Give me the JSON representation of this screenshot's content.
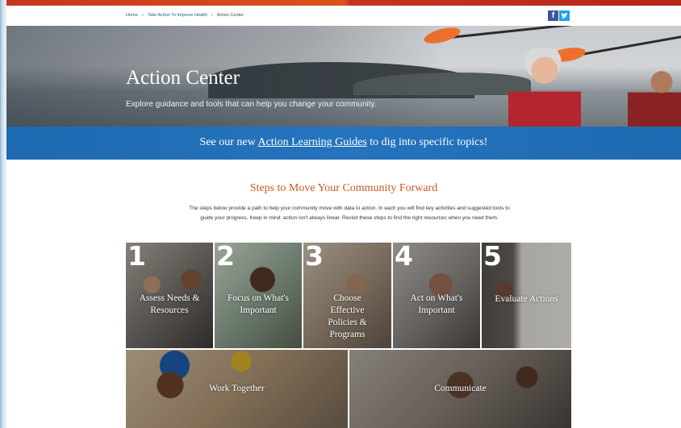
{
  "breadcrumb": {
    "home": "Home",
    "sep1": "»",
    "parent": "Take Action To Improve Health",
    "sep2": "»",
    "current": "Action Center"
  },
  "social": {
    "facebook": "f",
    "twitter": "t"
  },
  "hero": {
    "title": "Action Center",
    "subtitle": "Explore guidance and tools that can help you change your community."
  },
  "banner": {
    "prefix": "See our new ",
    "link": "Action Learning Guides",
    "suffix": " to dig into specific topics!"
  },
  "steps": {
    "title": "Steps to Move Your Community Forward",
    "description": "The steps below provide a path to help your community move with data to action. In each you will find key activities and suggested tools to guide your progress. Keep in mind: action isn't always linear. Revisit these steps to find the right resources when you need them.",
    "tiles": [
      {
        "number": "1",
        "label": "Assess Needs & Resources"
      },
      {
        "number": "2",
        "label": "Focus on What's Important"
      },
      {
        "number": "3",
        "label": "Choose Effective Policies & Programs"
      },
      {
        "number": "4",
        "label": "Act on What's Important"
      },
      {
        "number": "5",
        "label": "Evaluate Actions"
      }
    ],
    "wide_tiles": [
      {
        "label": "Work Together"
      },
      {
        "label": "Communicate"
      }
    ]
  },
  "colors": {
    "accent_orange": "#c4591f",
    "banner_blue": "#2574be",
    "top_stripe": "#c8331e"
  }
}
